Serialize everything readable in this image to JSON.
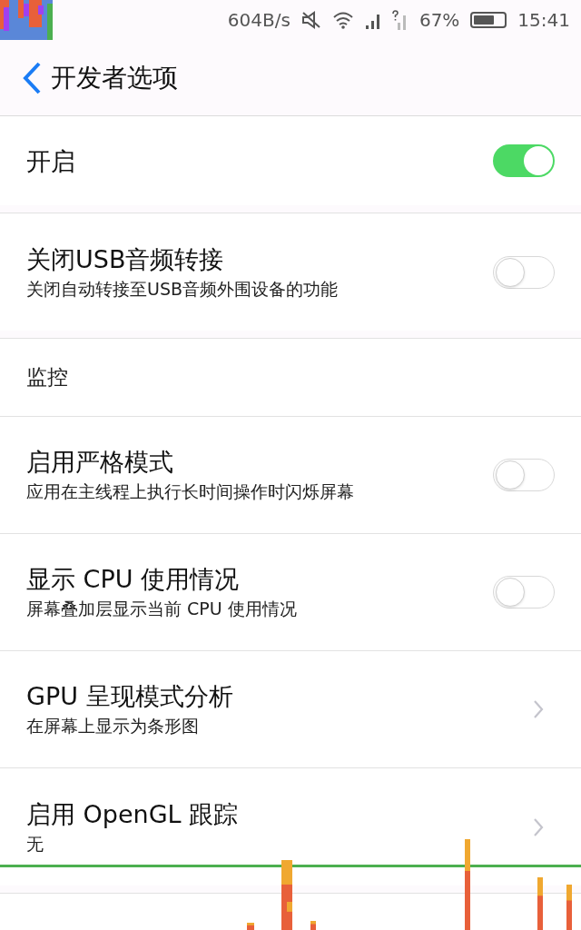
{
  "status_bar": {
    "net_speed": "604B/s",
    "battery": "67%",
    "time": "15:41"
  },
  "header": {
    "title": "开发者选项"
  },
  "sections": [
    {
      "items": [
        {
          "kind": "toggle",
          "title": "开启",
          "on": true
        }
      ]
    },
    {
      "items": [
        {
          "kind": "toggle",
          "title": "关闭USB音频转接",
          "subtitle": "关闭自动转接至USB音频外围设备的功能",
          "on": false
        }
      ]
    },
    {
      "header": "监控",
      "items": [
        {
          "kind": "toggle",
          "title": "启用严格模式",
          "subtitle": "应用在主线程上执行长时间操作时闪烁屏幕",
          "on": false
        },
        {
          "kind": "toggle",
          "title": "显示 CPU 使用情况",
          "subtitle": "屏幕叠加层显示当前 CPU 使用情况",
          "on": false
        },
        {
          "kind": "link",
          "title": "GPU 呈现模式分析",
          "subtitle": "在屏幕上显示为条形图"
        },
        {
          "kind": "link",
          "title": "启用 OpenGL 跟踪",
          "subtitle": "无"
        }
      ]
    }
  ]
}
